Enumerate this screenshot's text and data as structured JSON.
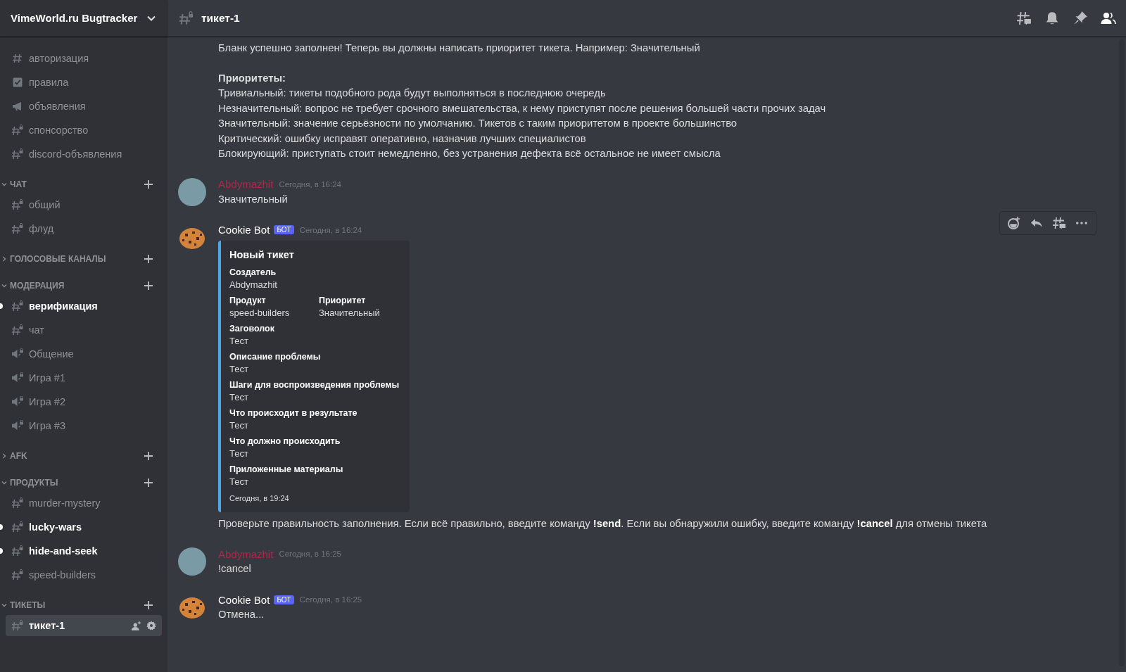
{
  "server": {
    "name": "VimeWorld.ru Bugtracker"
  },
  "sidebar": {
    "channels": [
      {
        "name": "авторизация",
        "kind": "text",
        "unread": false,
        "selected": false
      },
      {
        "name": "правила",
        "kind": "rules",
        "unread": false,
        "selected": false
      },
      {
        "name": "объявления",
        "kind": "announcement",
        "unread": false,
        "selected": false
      },
      {
        "name": "спонсорство",
        "kind": "text-locked",
        "unread": false,
        "selected": false
      },
      {
        "name": "discord-объявления",
        "kind": "text-locked",
        "unread": false,
        "selected": false
      }
    ],
    "categories": [
      {
        "name": "ЧАТ",
        "expanded": true,
        "channels": [
          {
            "name": "общий",
            "kind": "text-locked",
            "unread": false,
            "selected": false
          },
          {
            "name": "флуд",
            "kind": "text-locked",
            "unread": false,
            "selected": false
          }
        ]
      },
      {
        "name": "ГОЛОСОВЫЕ КАНАЛЫ",
        "expanded": false
      },
      {
        "name": "МОДЕРАЦИЯ",
        "expanded": true,
        "channels": [
          {
            "name": "верификация",
            "kind": "text-locked",
            "unread": true,
            "selected": false
          },
          {
            "name": "чат",
            "kind": "text-locked",
            "unread": false,
            "selected": false
          },
          {
            "name": "Общение",
            "kind": "voice-locked",
            "unread": false,
            "selected": false
          },
          {
            "name": "Игра #1",
            "kind": "voice-locked",
            "unread": false,
            "selected": false
          },
          {
            "name": "Игра #2",
            "kind": "voice-locked",
            "unread": false,
            "selected": false
          },
          {
            "name": "Игра #3",
            "kind": "voice-locked",
            "unread": false,
            "selected": false
          }
        ]
      },
      {
        "name": "AFK",
        "expanded": false
      },
      {
        "name": "ПРОДУКТЫ",
        "expanded": true,
        "channels": [
          {
            "name": "murder-mystery",
            "kind": "text-locked",
            "unread": false,
            "selected": false
          },
          {
            "name": "lucky-wars",
            "kind": "text-locked",
            "unread": true,
            "selected": false
          },
          {
            "name": "hide-and-seek",
            "kind": "text-locked",
            "unread": true,
            "selected": false
          },
          {
            "name": "speed-builders",
            "kind": "text-locked",
            "unread": false,
            "selected": false
          }
        ]
      },
      {
        "name": "ТИКЕТЫ",
        "expanded": true,
        "channels": [
          {
            "name": "тикет-1",
            "kind": "text-locked",
            "unread": false,
            "selected": true
          }
        ]
      }
    ]
  },
  "header": {
    "channel": "тикет-1"
  },
  "messages": [
    {
      "kind": "continuation",
      "hovered": false,
      "lines": [
        {
          "kind": "plain",
          "text": "Бланк успешно заполнен! Теперь вы должны написать приоритет тикета. Например: Значительный"
        },
        {
          "kind": "heading",
          "text": "Приоритеты:"
        },
        {
          "kind": "plain",
          "text": "Тривиальный: тикеты подобного рода будут выполняться в последнюю очередь"
        },
        {
          "kind": "plain",
          "text": "Незначительный: вопрос не требует срочного вмешательства, к нему приступят после решения большей части прочих задач"
        },
        {
          "kind": "plain",
          "text": "Значительный: значение серьёзности по умолчанию. Тикетов с таким приоритетом в проекте большинство"
        },
        {
          "kind": "plain",
          "text": "Критический: ошибку исправят оперативно, назначив лучших специалистов"
        },
        {
          "kind": "plain",
          "text": "Блокирующий: приступать стоит немедленно, без устранения дефекта всё остальное не имеет смысла"
        }
      ]
    },
    {
      "kind": "group",
      "hovered": false,
      "author": "Abdymazhit",
      "avatar": {
        "kind": "user"
      },
      "time": "Сегодня, в 16:24",
      "lines": [
        {
          "kind": "plain",
          "text": "Значительный"
        }
      ]
    },
    {
      "kind": "group",
      "hovered": true,
      "author": "Cookie Bot",
      "avatar": {
        "kind": "cookie"
      },
      "badge": "БОТ",
      "time": "Сегодня, в 16:24",
      "embed": {
        "title": "Новый тикет",
        "fields": [
          {
            "name": "Создатель",
            "value": "Abdymazhit",
            "inline": false
          },
          {
            "name": "Продукт",
            "value": "speed-builders",
            "inline": true
          },
          {
            "name": "Приоритет",
            "value": "Значительный",
            "inline": true
          },
          {
            "name": "Заговолок",
            "value": "Тест",
            "inline": false
          },
          {
            "name": "Описание проблемы",
            "value": "Тест",
            "inline": false
          },
          {
            "name": "Шаги для воспроизведения проблемы",
            "value": "Тест",
            "inline": false
          },
          {
            "name": "Что происходит в результате",
            "value": "Тест",
            "inline": false
          },
          {
            "name": "Что должно происходить",
            "value": "Тест",
            "inline": false
          },
          {
            "name": "Приложенные материалы",
            "value": "Тест",
            "inline": false
          }
        ],
        "footer": "Сегодня, в 19:24"
      },
      "after": "Проверьте правильность заполнения. Если всё правильно, введите команду **!send**. Если вы обнаружили ошибку, введите команду **!cancel** для отмены тикета"
    },
    {
      "kind": "group",
      "hovered": false,
      "author": "Abdymazhit",
      "avatar": {
        "kind": "user"
      },
      "time": "Сегодня, в 16:25",
      "lines": [
        {
          "kind": "plain",
          "text": "!cancel"
        }
      ]
    },
    {
      "kind": "group",
      "hovered": false,
      "author": "Cookie Bot",
      "avatar": {
        "kind": "cookie"
      },
      "badge": "БОТ",
      "time": "Сегодня, в 16:25",
      "lines": [
        {
          "kind": "plain",
          "text": "Отмена..."
        }
      ]
    }
  ]
}
